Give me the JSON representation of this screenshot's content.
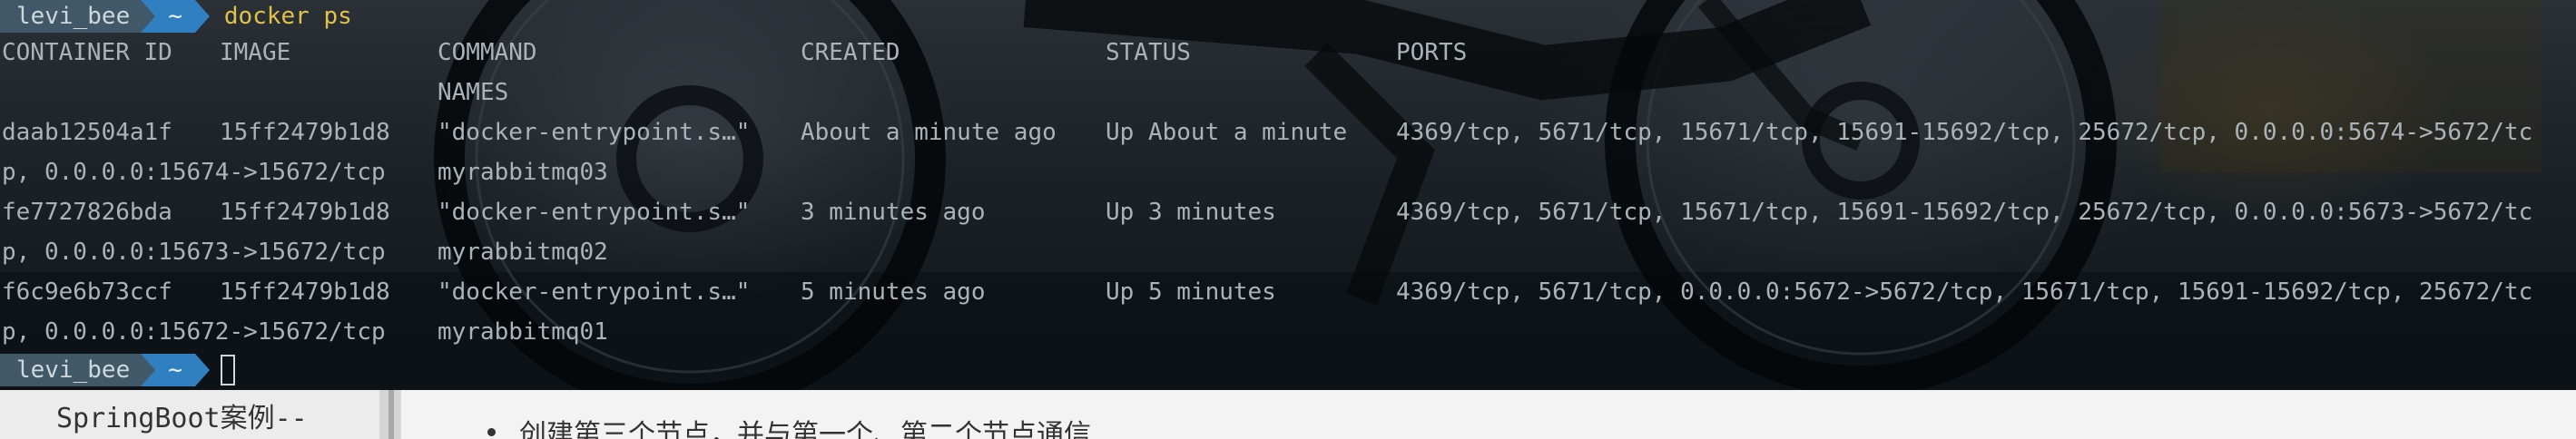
{
  "terminal": {
    "prompt1": {
      "user": "levi_bee",
      "dir": "~",
      "command": "docker ps"
    },
    "headers": {
      "container_id": "CONTAINER ID",
      "image": "IMAGE",
      "command": "COMMAND",
      "created": "CREATED",
      "status": "STATUS",
      "ports": "PORTS",
      "names": "NAMES"
    },
    "rows": [
      {
        "container_id": "daab12504a1f",
        "image": "15ff2479b1d8",
        "command": "\"docker-entrypoint.s…\"",
        "created": "About a minute ago",
        "status": "Up About a minute",
        "ports": "4369/tcp, 5671/tcp, 15671/tcp, 15691-15692/tcp, 25672/tcp, 0.0.0.0:5674->5672/tc",
        "ports_cont": "p, 0.0.0.0:15674->15672/tcp",
        "names": "myrabbitmq03"
      },
      {
        "container_id": "fe7727826bda",
        "image": "15ff2479b1d8",
        "command": "\"docker-entrypoint.s…\"",
        "created": "3 minutes ago",
        "status": "Up 3 minutes",
        "ports": "4369/tcp, 5671/tcp, 15671/tcp, 15691-15692/tcp, 25672/tcp, 0.0.0.0:5673->5672/tc",
        "ports_cont": "p, 0.0.0.0:15673->15672/tcp",
        "names": "myrabbitmq02"
      },
      {
        "container_id": "f6c9e6b73ccf",
        "image": "15ff2479b1d8",
        "command": "\"docker-entrypoint.s…\"",
        "created": "5 minutes ago",
        "status": "Up 5 minutes",
        "ports": "4369/tcp, 5671/tcp, 0.0.0.0:5672->5672/tcp, 15671/tcp, 15691-15692/tcp, 25672/tc",
        "ports_cont": "p, 0.0.0.0:15672->15672/tcp",
        "names": "myrabbitmq01"
      }
    ],
    "prompt2": {
      "user": "levi_bee",
      "dir": "~"
    }
  },
  "bottom": {
    "sidebar_item": "SpringBoot案例--",
    "doc_text": "创建第三个节点，并与第一个、第二个节点通信"
  },
  "colors": {
    "prompt_user_bg": "#415868",
    "prompt_dir_bg": "#2f7fc1",
    "command_text": "#e0c24a",
    "terminal_text": "#aab4b8"
  },
  "icons": {
    "prompt_separator": "powerline-arrow-icon",
    "cursor": "block-cursor-icon"
  }
}
